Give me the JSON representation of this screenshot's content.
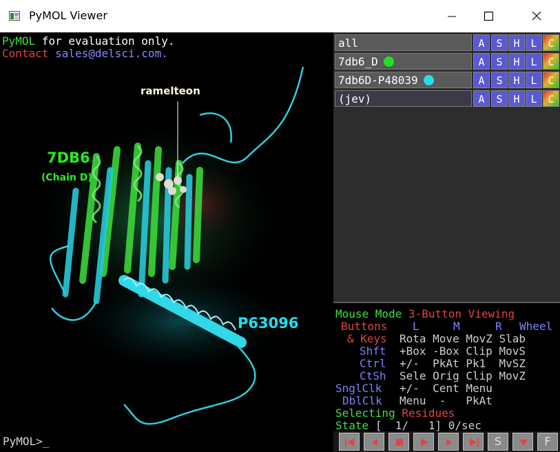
{
  "window": {
    "title": "PyMOL Viewer",
    "icon": "pymol-app-icon",
    "controls": [
      "minimize-icon",
      "maximize-icon",
      "close-icon"
    ]
  },
  "viewer": {
    "eval_line1_part1": "PyMOL",
    "eval_line1_part2": " for evaluation only.",
    "eval_line2_part1": "Contact",
    "eval_line2_part2": " sales@delsci.com.",
    "labels": {
      "ligand": "ramelteon",
      "structure": "7DB6",
      "chain": "(Chain D)",
      "model": "P63096"
    },
    "prompt": "PyMOL>_"
  },
  "objects": [
    {
      "name": "all",
      "dot_color": ""
    },
    {
      "name": "7db6_D",
      "dot_color": "#22e022"
    },
    {
      "name": "7db6D-P48039",
      "dot_color": "#22e0e8"
    },
    {
      "name": "(jev)",
      "dot_color": ""
    }
  ],
  "object_buttons": [
    "A",
    "S",
    "H",
    "L",
    "C"
  ],
  "mouse": {
    "mode_label": "Mouse Mode",
    "mode_value": "3-Button Viewing",
    "buttons_label": "Buttons",
    "col_l": "L",
    "col_m": "M",
    "col_r": "R",
    "col_wheel": "Wheel",
    "keys_label": "& Keys",
    "keys_row": "Rota Move MovZ Slab",
    "shft_label": "Shft",
    "shft_row": "+Box -Box Clip MovS",
    "ctrl_label": "Ctrl",
    "ctrl_row": "+/-  PkAt Pk1  MvSZ",
    "ctsh_label": "CtSh",
    "ctsh_row": "Sele Orig Clip MovZ",
    "snglclk_label": "SnglClk",
    "snglclk_row": "+/-  Cent Menu",
    "dblclk_label": "DblClk",
    "dblclk_row": "Menu  -   PkAt",
    "selecting_label": "Selecting",
    "selecting_value": "Residues",
    "state_label": "State",
    "state_value": "[  1/   1] 0/sec"
  },
  "transport": [
    "rewind-icon",
    "step-back-icon",
    "stop-icon",
    "play-icon",
    "step-forward-icon",
    "fast-forward-icon",
    "S",
    "scene-menu-icon",
    "F"
  ],
  "transport_labels": {
    "s": "S",
    "f": "F"
  }
}
